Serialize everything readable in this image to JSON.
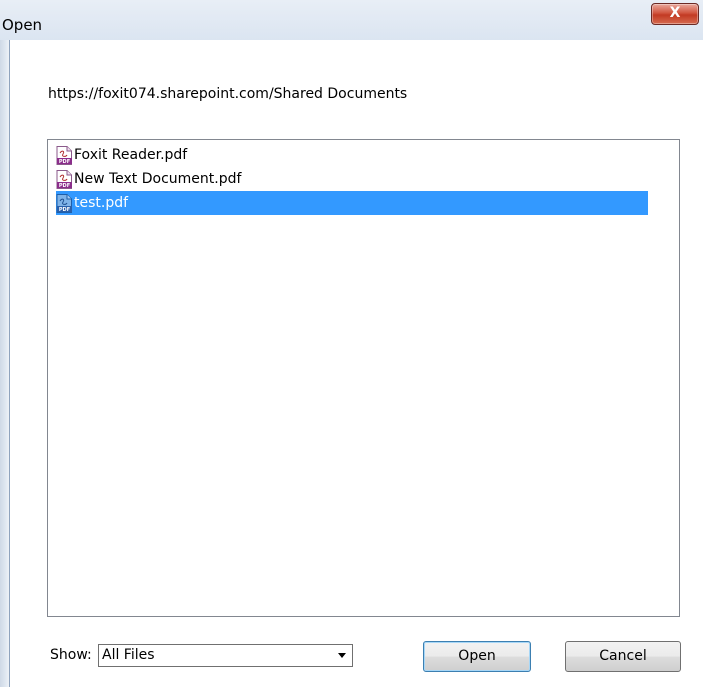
{
  "window": {
    "title": "Open",
    "close_glyph": "X"
  },
  "location": {
    "path": "https://foxit074.sharepoint.com/Shared Documents"
  },
  "file_list": {
    "items": [
      {
        "name": "Foxit Reader.pdf",
        "icon": "pdf-icon",
        "selected": false
      },
      {
        "name": "New Text Document.pdf",
        "icon": "pdf-icon",
        "selected": false
      },
      {
        "name": "test.pdf",
        "icon": "pdf-icon",
        "selected": true
      }
    ]
  },
  "filter": {
    "label": "Show:",
    "value": "All Files"
  },
  "buttons": {
    "open_label": "Open",
    "cancel_label": "Cancel"
  },
  "colors": {
    "selection": "#3399ff",
    "pdf_accent": "#8b2d8b"
  }
}
